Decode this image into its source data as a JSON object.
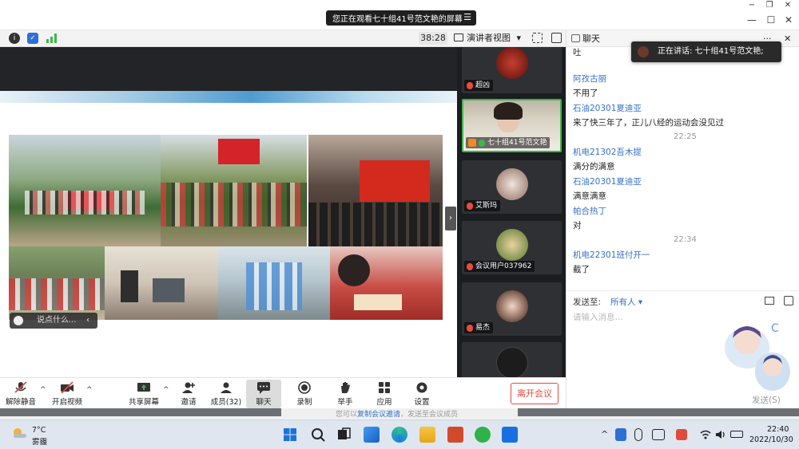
{
  "titlebar": {
    "share_notice": "您正在观看七十组41号范文艳的屏幕",
    "menu_glyph": "☰",
    "win_minimize": "−",
    "win_restore": "❐",
    "win_close": "✕",
    "win2_minimize": "—",
    "win2_maximize": "☐",
    "win2_close": "✕"
  },
  "toolbar": {
    "timer": "38:28",
    "view_mode": "演讲者视图",
    "view_caret": "▾"
  },
  "stage": {
    "chat_placeholder": "说点什么...",
    "chat_arrow": "‹",
    "collapse_arrow": "›"
  },
  "participants": [
    {
      "name": "超凶",
      "mic": "muted"
    },
    {
      "name": "七十组41号范文艳",
      "mic": "on",
      "host": true
    },
    {
      "name": "艾斯玛",
      "mic": "muted"
    },
    {
      "name": "会议用户037962",
      "mic": "muted"
    },
    {
      "name": "易杰",
      "mic": "muted"
    }
  ],
  "chat": {
    "title": "聊天",
    "more": "···",
    "close": "✕",
    "speaking": "正在讲话: 七十组41号范文艳;",
    "partial_top": "吐",
    "messages": [
      {
        "type": "sender",
        "text": "阿孜古丽"
      },
      {
        "type": "text",
        "text": "不用了"
      },
      {
        "type": "sender",
        "text": "石油20301夏迪亚"
      },
      {
        "type": "text",
        "text": "来了快三年了，正儿八经的运动会没见过"
      },
      {
        "type": "time",
        "text": "22:25"
      },
      {
        "type": "sender",
        "text": "机电21302吾木提"
      },
      {
        "type": "text",
        "text": "满分的满意"
      },
      {
        "type": "sender",
        "text": "石油20301夏迪亚"
      },
      {
        "type": "text",
        "text": "满意满意"
      },
      {
        "type": "sender",
        "text": "帕合热丁"
      },
      {
        "type": "text",
        "text": "对"
      },
      {
        "type": "time",
        "text": "22:34"
      },
      {
        "type": "sender",
        "text": "机电22301班付开一"
      },
      {
        "type": "text",
        "text": "截了"
      }
    ],
    "send_to_label": "发送至:",
    "send_to_value": "所有人 ▾",
    "input_placeholder": "请输入消息...",
    "send_button": "发送(S)"
  },
  "bottombar": {
    "unmute": "解除静音",
    "start_video": "开启视频",
    "share_screen": "共享屏幕",
    "invite": "邀请",
    "members": "成员(32)",
    "chat": "聊天",
    "record": "录制",
    "raise_hand": "举手",
    "apps": "应用",
    "settings": "设置",
    "leave": "离开会议",
    "caret": "^"
  },
  "strip": {
    "hint_prefix": "您可以",
    "hint_link": "复制会议邀请",
    "hint_suffix": "，发送至会议成员"
  },
  "taskbar": {
    "temperature": "7°C",
    "weather": "雾霾",
    "time": "22:40",
    "date": "2022/10/30",
    "tray_caret": "^"
  },
  "colors": {
    "accent_blue": "#3570c9",
    "leave_red": "#e24a3b",
    "speaking_green": "#3fb64c"
  }
}
